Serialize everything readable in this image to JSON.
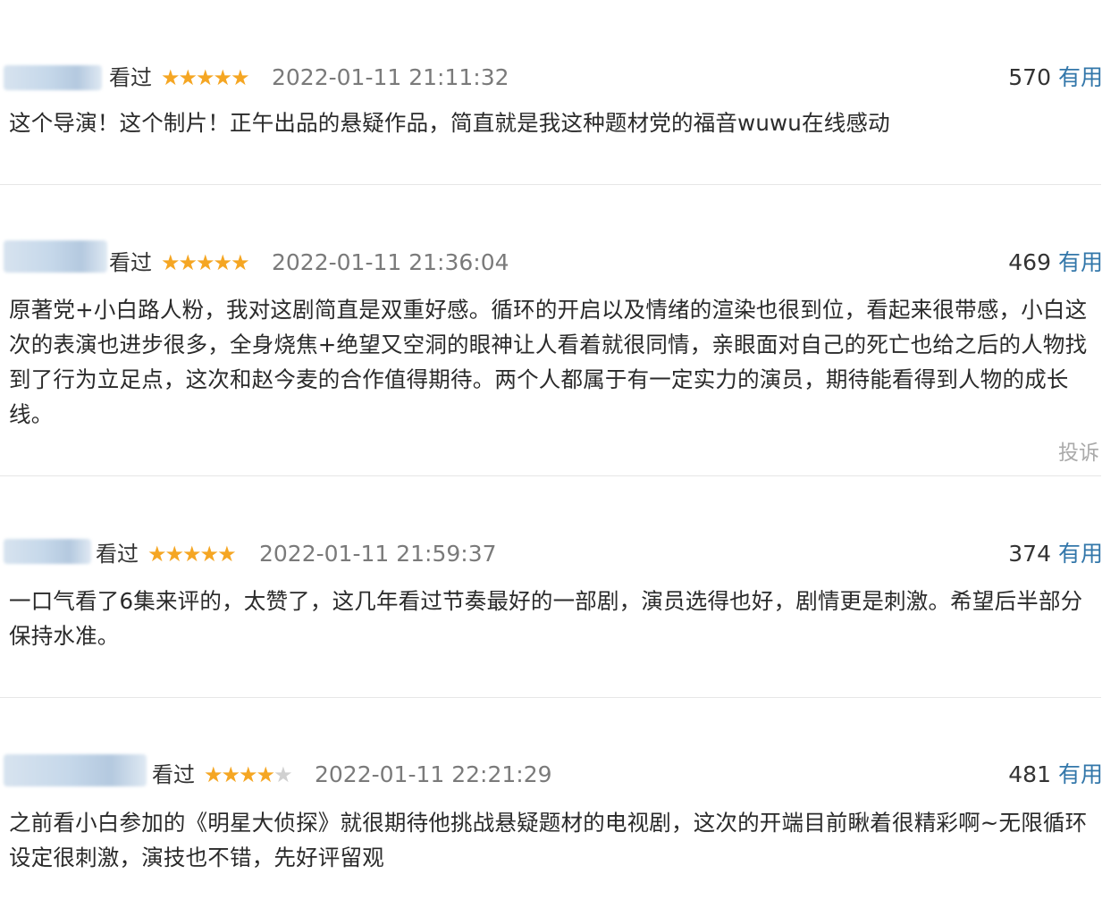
{
  "reviews": [
    {
      "status": "看过",
      "rating": 5,
      "time": "2022-01-11 21:11:32",
      "useful_count": "570",
      "useful_label": "有用",
      "content": "这个导演！这个制片！正午出品的悬疑作品，简直就是我这种题材党的福音wuwu在线感动"
    },
    {
      "status": "看过",
      "rating": 5,
      "time": "2022-01-11 21:36:04",
      "useful_count": "469",
      "useful_label": "有用",
      "content": "原著党+小白路人粉，我对这剧简直是双重好感。循环的开启以及情绪的渲染也很到位，看起来很带感，小白这次的表演也进步很多，全身烧焦+绝望又空洞的眼神让人看着就很同情，亲眼面对自己的死亡也给之后的人物找到了行为立足点，这次和赵今麦的合作值得期待。两个人都属于有一定实力的演员，期待能看得到人物的成长线。",
      "report_label": "投诉"
    },
    {
      "status": "看过",
      "rating": 5,
      "time": "2022-01-11 21:59:37",
      "useful_count": "374",
      "useful_label": "有用",
      "content": "一口气看了6集来评的，太赞了，这几年看过节奏最好的一部剧，演员选得也好，剧情更是刺激。希望后半部分保持水准。"
    },
    {
      "status": "看过",
      "rating": 4,
      "time": "2022-01-11 22:21:29",
      "useful_count": "481",
      "useful_label": "有用",
      "content": "之前看小白参加的《明星大侦探》就很期待他挑战悬疑题材的电视剧，这次的开端目前瞅着很精彩啊~无限循环设定很刺激，演技也不错，先好评留观"
    }
  ],
  "colors": {
    "star": "#f5a623",
    "useful_link": "#3377aa",
    "time": "#7a7a7a"
  }
}
